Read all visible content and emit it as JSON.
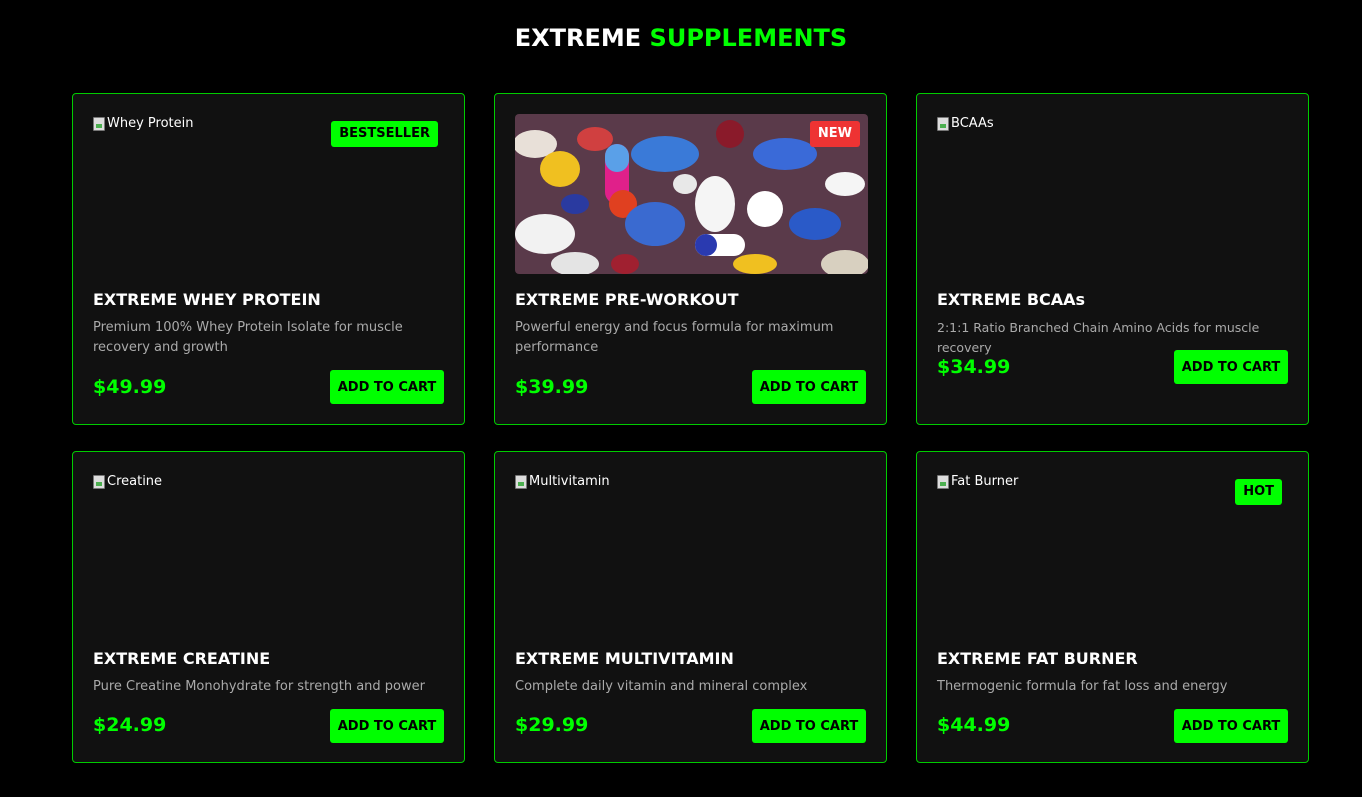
{
  "header": {
    "title_part1": "EXTREME",
    "title_part2": "SUPPLEMENTS",
    "accent_color": "#00ff00"
  },
  "products": [
    {
      "image_alt": "Whey Protein",
      "badge": "BESTSELLER",
      "name": "EXTREME WHEY PROTEIN",
      "description": "Premium 100% Whey Protein Isolate for muscle recovery and growth",
      "price": "$49.99",
      "button": "ADD TO CART"
    },
    {
      "image_alt": "",
      "badge": "NEW",
      "name": "EXTREME PRE-WORKOUT",
      "description": "Powerful energy and focus formula for maximum performance",
      "price": "$39.99",
      "button": "ADD TO CART"
    },
    {
      "image_alt": "BCAAs",
      "badge": "",
      "name": "EXTREME BCAAs",
      "description": "2:1:1 Ratio Branched Chain Amino Acids for muscle recovery",
      "price": "$34.99",
      "button": "ADD TO CART"
    },
    {
      "image_alt": "Creatine",
      "badge": "",
      "name": "EXTREME CREATINE",
      "description": "Pure Creatine Monohydrate for strength and power",
      "price": "$24.99",
      "button": "ADD TO CART"
    },
    {
      "image_alt": "Multivitamin",
      "badge": "",
      "name": "EXTREME MULTIVITAMIN",
      "description": "Complete daily vitamin and mineral complex",
      "price": "$29.99",
      "button": "ADD TO CART"
    },
    {
      "image_alt": "Fat Burner",
      "badge": "HOT",
      "name": "EXTREME FAT BURNER",
      "description": "Thermogenic formula for fat loss and energy",
      "price": "$44.99",
      "button": "ADD TO CART"
    }
  ]
}
